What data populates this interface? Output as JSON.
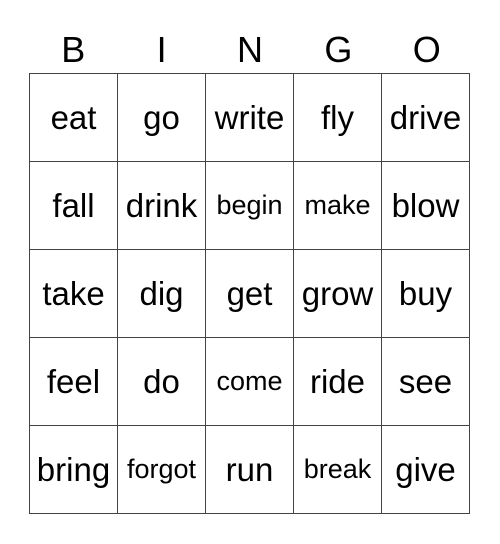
{
  "header": [
    "B",
    "I",
    "N",
    "G",
    "O"
  ],
  "cells": [
    [
      "eat",
      "go",
      "write",
      "fly",
      "drive"
    ],
    [
      "fall",
      "drink",
      "begin",
      "make",
      "blow"
    ],
    [
      "take",
      "dig",
      "get",
      "grow",
      "buy"
    ],
    [
      "feel",
      "do",
      "come",
      "ride",
      "see"
    ],
    [
      "bring",
      "forgot",
      "run",
      "break",
      "give"
    ]
  ]
}
